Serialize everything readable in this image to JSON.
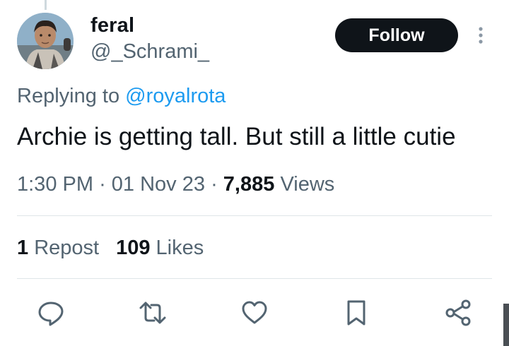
{
  "tweet": {
    "author": {
      "display_name": "feral",
      "handle": "@_Schrami_"
    },
    "follow_label": "Follow",
    "reply_prefix": "Replying to",
    "reply_mention": "@royalrota",
    "text": "Archie is getting tall. But still a little cutie",
    "time": "1:30 PM",
    "date": "01 Nov 23",
    "views_count": "7,885",
    "views_label": "Views",
    "separator": "·",
    "reposts_count": "1",
    "reposts_label": "Repost",
    "likes_count": "109",
    "likes_label": "Likes"
  },
  "colors": {
    "text_primary": "#0f1419",
    "text_secondary": "#536471",
    "accent": "#1d9bf0",
    "follow_bg": "#0f1419",
    "action_icon": "#536471"
  },
  "actions": [
    {
      "icon": "reply-icon"
    },
    {
      "icon": "repost-icon"
    },
    {
      "icon": "like-icon"
    },
    {
      "icon": "bookmark-icon"
    },
    {
      "icon": "share-icon"
    }
  ]
}
